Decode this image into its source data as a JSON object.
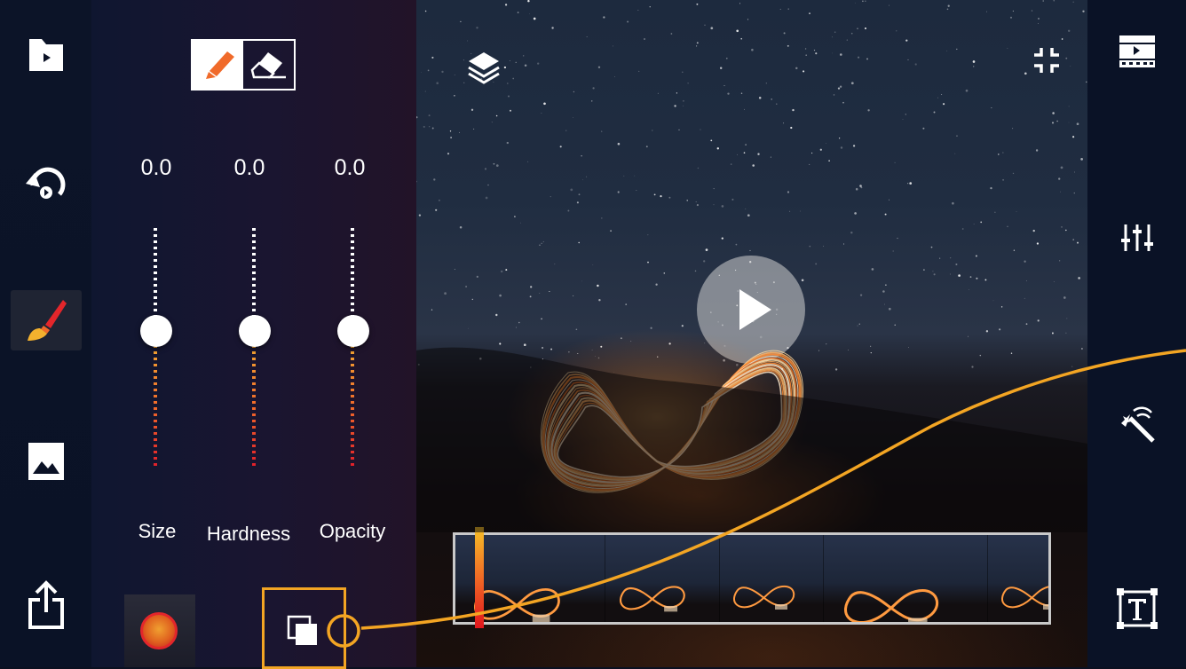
{
  "left_toolbar": {
    "items": [
      {
        "icon": "video-folder-icon",
        "active": false
      },
      {
        "icon": "undo-icon",
        "active": false
      },
      {
        "icon": "brush-icon",
        "active": true
      },
      {
        "icon": "image-icon",
        "active": false
      },
      {
        "icon": "share-icon",
        "active": false
      }
    ]
  },
  "brush_panel": {
    "mode_toggle": {
      "options": [
        "pen-icon",
        "eraser-icon"
      ],
      "selected": "pen-icon"
    },
    "sliders": [
      {
        "label": "Size",
        "value_text": "0.0",
        "level": 0.45
      },
      {
        "label": "Hardness",
        "value_text": "0.0",
        "level": 0.45
      },
      {
        "label": "Opacity",
        "value_text": "0.0",
        "level": 0.45
      }
    ],
    "color_swatch": {
      "color": "#e8661f"
    },
    "blend_button": {
      "icon": "blend-layers-icon",
      "highlighted": true
    }
  },
  "canvas": {
    "layers_icon": "layers-icon",
    "collapse_icon": "collapse-icon",
    "play_icon": "play-icon",
    "filmstrip": {
      "frame_count": 6,
      "playhead_position": 0.04
    }
  },
  "right_toolbar": {
    "items": [
      "filmstrip-icon",
      "adjust-sliders-icon",
      "magic-wand-icon",
      "text-icon"
    ]
  },
  "colors": {
    "accent": "#f3a523",
    "active_red": "#e3262b",
    "panel_bg": "#0a1226"
  }
}
